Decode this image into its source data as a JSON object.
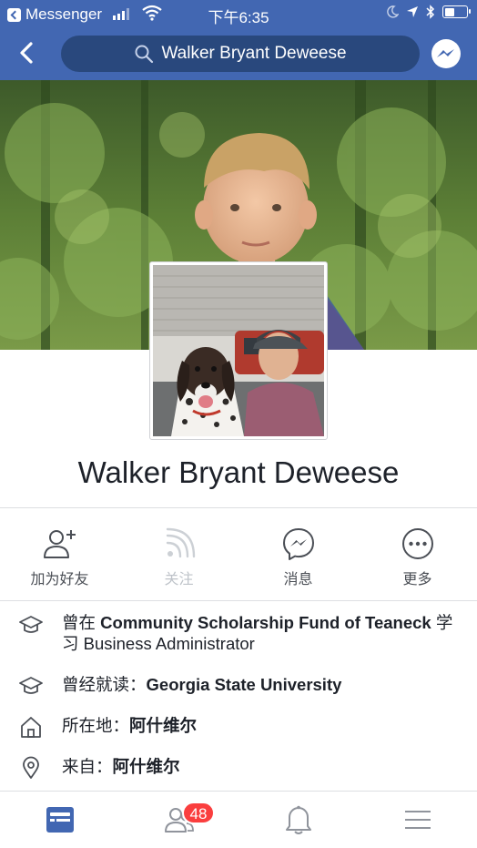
{
  "status_bar": {
    "back_app": "Messenger",
    "time": "下午6:35"
  },
  "header": {
    "search_text": "Walker Bryant Deweese",
    "icons": [
      "back-arrow-icon",
      "search-icon",
      "messenger-icon"
    ]
  },
  "profile": {
    "name": "Walker Bryant Deweese"
  },
  "actions": [
    {
      "label": "加为好友",
      "icon": "add-friend-icon",
      "enabled": true
    },
    {
      "label": "关注",
      "icon": "follow-rss-icon",
      "enabled": false
    },
    {
      "label": "消息",
      "icon": "messenger-icon",
      "enabled": true
    },
    {
      "label": "更多",
      "icon": "more-icon",
      "enabled": true
    }
  ],
  "info": {
    "work": {
      "prefix": "曾在",
      "org": "Community Scholarship Fund of Teaneck",
      "mid": "学习",
      "field": "Business Administrator"
    },
    "education": {
      "prefix": "曾经就读：",
      "school": "Georgia State University"
    },
    "lives": {
      "prefix": "所在地：",
      "place": "阿什维尔"
    },
    "from": {
      "prefix": "来自：",
      "place": "阿什维尔"
    }
  },
  "tabbar": {
    "friend_requests_badge": "48",
    "colors": {
      "active": "#4267b2",
      "inactive": "#90949c",
      "badge": "#fa3e3e"
    }
  },
  "colors": {
    "brand": "#4267b2",
    "search_bg": "#29487d"
  }
}
